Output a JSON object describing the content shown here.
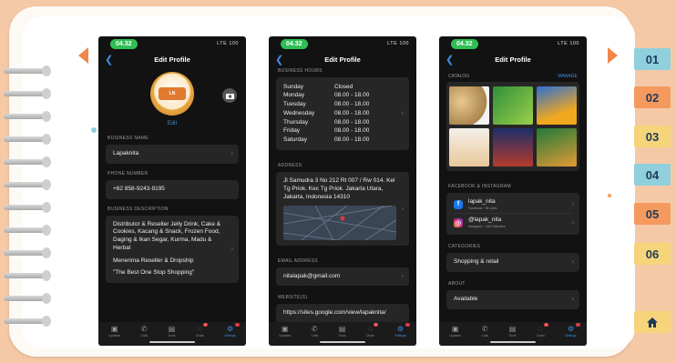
{
  "colors": {
    "accent": "#3d8fe0",
    "status_green": "#2fbf55",
    "badge_red": "#e0353b",
    "arrow_orange": "#f0864b"
  },
  "tabs": [
    {
      "label": "01",
      "color": "#8fd0dc"
    },
    {
      "label": "02",
      "color": "#f59a5e"
    },
    {
      "label": "03",
      "color": "#f6d47a"
    },
    {
      "label": "04",
      "color": "#8fd0dc"
    },
    {
      "label": "05",
      "color": "#f59a5e"
    },
    {
      "label": "06",
      "color": "#f6d47a"
    }
  ],
  "home_icon": "home-icon",
  "phone": {
    "time": "04.32",
    "status_right": "LTE 100",
    "title": "Edit Profile"
  },
  "screen1": {
    "edit_label": "Edit",
    "business_name_label": "BUSINESS NAME",
    "business_name": "Lapaknita",
    "phone_label": "PHONE NUMBER",
    "phone_number": "+62 858-9243-9195",
    "description_label": "BUSINESS DESCRIPTION",
    "description_1": "Distributor & Reseller Jelly Drink, Cake & Cookies, Kacang & Snack, Frozen Food, Daging & Ikan Segar, Kurma, Madu & Herbal",
    "description_2": "Menerima Reseller & Dropship",
    "description_3": "\"The Best One Stop Shopping\""
  },
  "screen2": {
    "hours_label": "BUSINESS HOURS",
    "hours": [
      {
        "day": "Sunday",
        "time": "Closed"
      },
      {
        "day": "Monday",
        "time": "08.00 - 18.00"
      },
      {
        "day": "Tuesday",
        "time": "08.00 - 18.00"
      },
      {
        "day": "Wednesday",
        "time": "08.00 - 18.00"
      },
      {
        "day": "Thursday",
        "time": "08.00 - 18.00"
      },
      {
        "day": "Friday",
        "time": "08.00 - 18.00"
      },
      {
        "day": "Saturday",
        "time": "08.00 - 18.00"
      }
    ],
    "address_label": "ADDRESS",
    "address": "Jl Samudra 3 No 212 Rt 007 / Rw 014. Kel Tg Priok. Kec Tg Priok. Jakarta Utara, Jakarta, Indonesia 14310",
    "email_label": "EMAIL ADDRESS",
    "email": "nitalapak@gmail.com",
    "website_label": "WEBSITE(S)",
    "website": "https://sites.google.com/view/lapaknita/"
  },
  "screen3": {
    "catalog_label": "CATALOG",
    "manage_label": "MANAGE",
    "social_label": "FACEBOOK & INSTAGRAM",
    "fb_name": "lapak_nita",
    "fb_sub": "Facebook · 36 Likes",
    "ig_name": "@lapak_nita",
    "ig_sub": "Instagram · 186 Followers",
    "categories_label": "CATEGORIES",
    "category": "Shopping & retail",
    "about_label": "ABOUT",
    "about": "Available"
  },
  "tabbar": {
    "items": [
      {
        "label": "Updates",
        "icon": "updates-icon",
        "badge": ""
      },
      {
        "label": "Calls",
        "icon": "phone-icon",
        "badge": ""
      },
      {
        "label": "Tools",
        "icon": "tools-icon",
        "badge": ""
      },
      {
        "label": "Chats",
        "icon": "chat-icon",
        "badge": "3"
      },
      {
        "label": "Settings",
        "icon": "gear-icon",
        "badge": "1"
      }
    ]
  }
}
